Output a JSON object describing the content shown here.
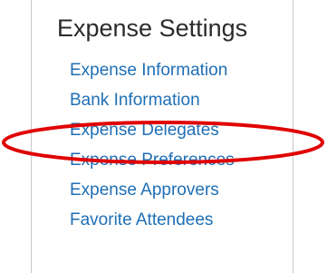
{
  "expense_settings": {
    "title": "Expense Settings",
    "items": [
      {
        "label": "Expense Information"
      },
      {
        "label": "Bank Information"
      },
      {
        "label": "Expense Delegates",
        "highlighted": true
      },
      {
        "label": "Expense Preferences"
      },
      {
        "label": "Expense Approvers"
      },
      {
        "label": "Favorite Attendees"
      }
    ]
  },
  "colors": {
    "link": "#1f6fb5",
    "title": "#2b2b2b",
    "highlight_oval": "#e00000"
  }
}
